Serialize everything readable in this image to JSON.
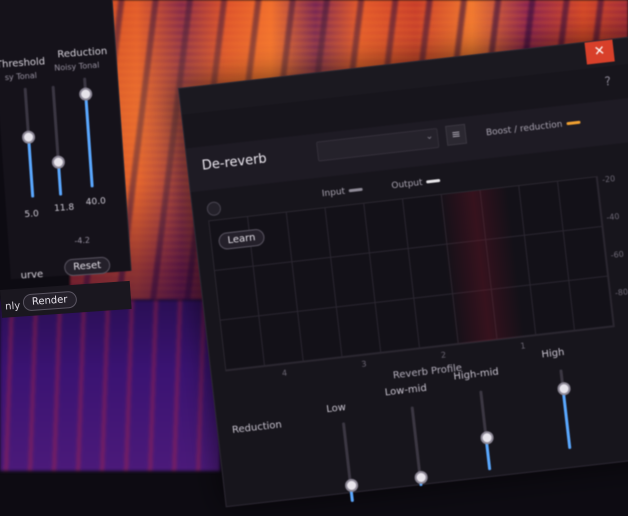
{
  "left_panel": {
    "threshold_label": "Threshold",
    "reduction_label": "Reduction",
    "threshold_sub": "sy  Tonal",
    "reduction_sub": "Noisy  Tonal",
    "threshold_value": "5.0",
    "value_mid": "11.8",
    "reduction_value": "40.0",
    "value_neg": "-4.2",
    "curve_label": "urve",
    "reset_label": "Reset",
    "only_label": "nly",
    "render_label": "Render",
    "slider_levels": [
      0.55,
      0.3,
      0.85
    ]
  },
  "dereverb": {
    "title": "De-reverb",
    "close_glyph": "✕",
    "help_glyph": "?",
    "menu_glyph": "≡",
    "chevron_glyph": "⌄",
    "legend": {
      "input": "Input",
      "output": "Output",
      "boost": "Boost / reduction",
      "colors": {
        "input": "#8e8a96",
        "output": "#e8e6ea",
        "boost": "#f0a030"
      }
    },
    "learn_label": "Learn",
    "db_ticks": [
      "-20",
      "-40",
      "-60",
      "-80"
    ],
    "freq_ticks": [
      "4",
      "3",
      "2",
      "1"
    ],
    "profile_label": "Reverb Profile",
    "reduction_label": "Reduction",
    "bands": [
      {
        "label": "Low",
        "level": 0.2
      },
      {
        "label": "Low-mid",
        "level": 0.1
      },
      {
        "label": "High-mid",
        "level": 0.4
      },
      {
        "label": "High",
        "level": 0.75
      }
    ]
  },
  "colors": {
    "accent": "#5aa8ff",
    "close": "#d8402a"
  }
}
